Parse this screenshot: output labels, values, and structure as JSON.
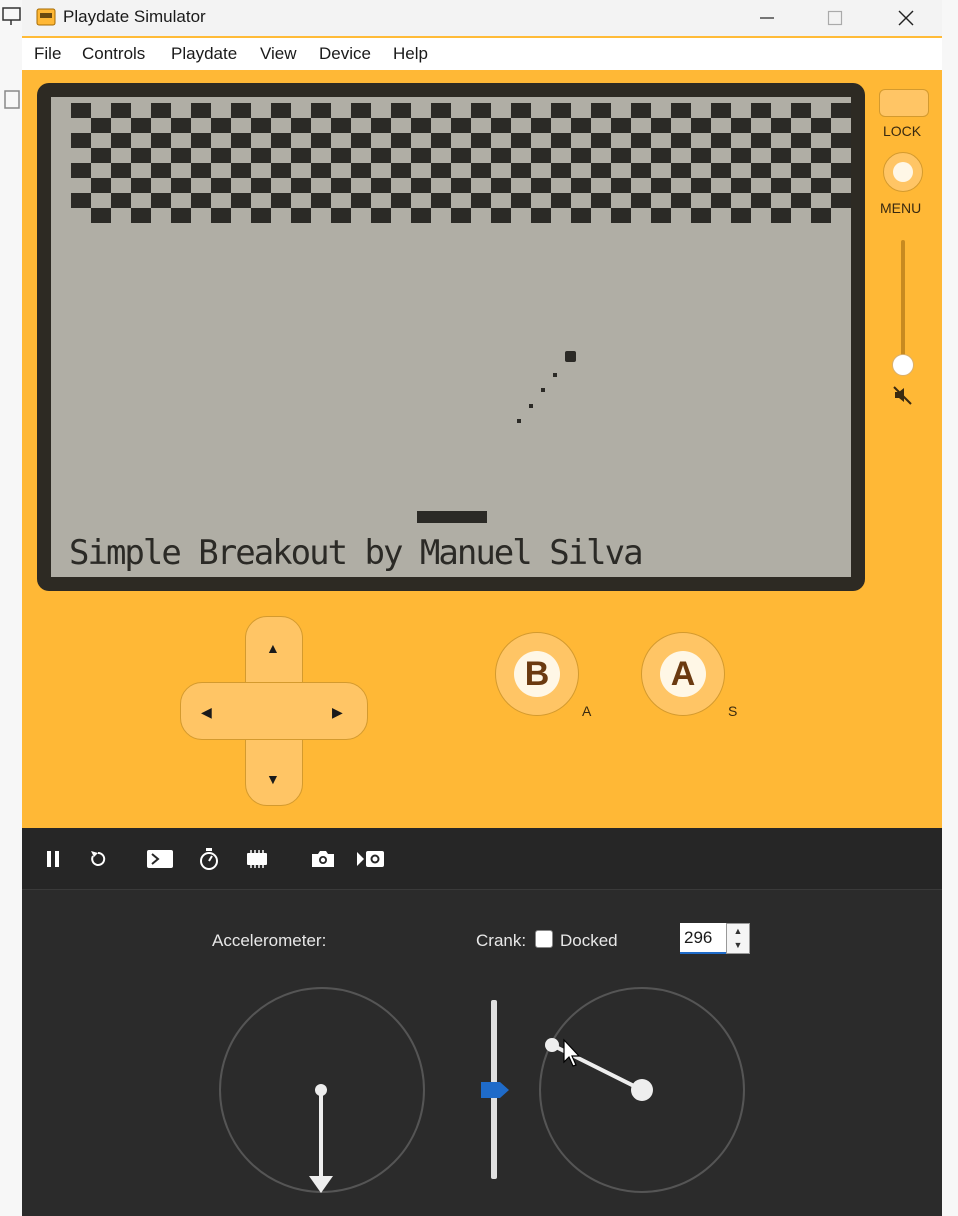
{
  "window": {
    "title": "Playdate Simulator",
    "app_icon": "playdate-app-icon"
  },
  "menu": {
    "items": [
      "File",
      "Controls",
      "Playdate",
      "View",
      "Device",
      "Help"
    ]
  },
  "device": {
    "lock_label": "LOCK",
    "menu_label": "MENU",
    "volume_level": 0.0,
    "volume_icon": "muted-speaker-icon",
    "b_button": "B",
    "b_key": "A",
    "a_button": "A",
    "a_key": "S",
    "dpad": {
      "up": "▲",
      "down": "▼",
      "left": "◀",
      "right": "▶"
    }
  },
  "game": {
    "caption": "Simple Breakout by Manuel Silva"
  },
  "toolbar": {
    "icons": [
      "pause-icon",
      "restart-icon",
      "console-icon",
      "stopwatch-icon",
      "device-memory-icon",
      "screenshot-icon",
      "record-video-icon"
    ]
  },
  "controls": {
    "accelerometer_label": "Accelerometer:",
    "crank_label": "Crank:",
    "docked_label": "Docked",
    "docked_checked": false,
    "crank_angle": "296"
  },
  "colors": {
    "device_body": "#ffb836",
    "screen_bg": "#b0aea5",
    "screen_ink": "#2b2a26",
    "panel_bg": "#2b2b2b",
    "crank_slider_thumb": "#1f6bc9"
  }
}
